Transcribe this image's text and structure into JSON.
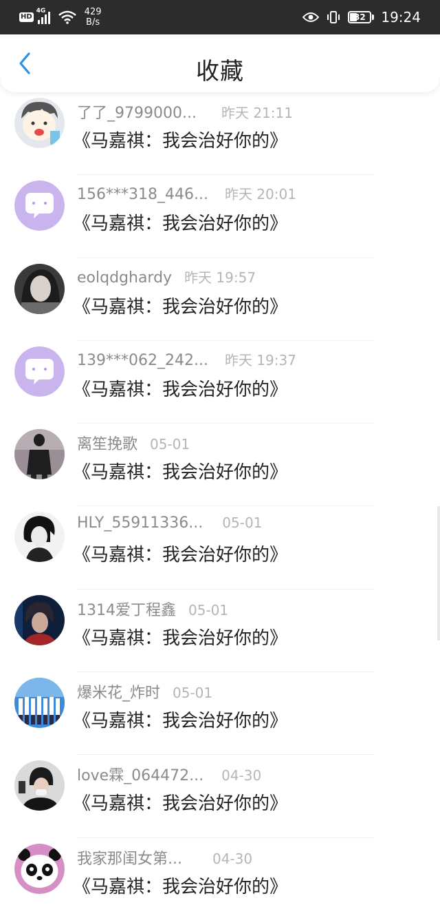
{
  "status_bar": {
    "hd": "HD",
    "signal_label": "4G",
    "net_speed_value": "429",
    "net_speed_unit": "B/s",
    "battery": "32",
    "time": "19:24"
  },
  "header": {
    "title": "收藏"
  },
  "items": [
    {
      "username": "了了_9799000...",
      "time": "昨天 21:11",
      "title": "《马嘉祺：我会治好你的》"
    },
    {
      "username": "156***318_446...",
      "time": "昨天 20:01",
      "title": "《马嘉祺：我会治好你的》"
    },
    {
      "username": "eolqdghardy",
      "time": "昨天 19:57",
      "title": "《马嘉祺：我会治好你的》"
    },
    {
      "username": "139***062_242...",
      "time": "昨天 19:37",
      "title": "《马嘉祺：我会治好你的》"
    },
    {
      "username": "离笙挽歌",
      "time": "05-01",
      "title": "《马嘉祺：我会治好你的》"
    },
    {
      "username": "HLY_55911336...",
      "time": "05-01",
      "title": "《马嘉祺：我会治好你的》"
    },
    {
      "username": "1314爱丁程鑫",
      "time": "05-01",
      "title": "《马嘉祺：我会治好你的》"
    },
    {
      "username": "爆米花_炸时",
      "time": "05-01",
      "title": "《马嘉祺：我会治好你的》"
    },
    {
      "username": "love霖_064472...",
      "time": "04-30",
      "title": "《马嘉祺：我会治好你的》"
    },
    {
      "username": "我家那闺女第...",
      "time": "04-30",
      "title": "《马嘉祺：我会治好你的》"
    }
  ],
  "colors": {
    "accent": "#2e8fe6",
    "status_bar_bg": "#2c2c2c",
    "username": "#8a8a8a",
    "time": "#b5b5b5",
    "title": "#222222"
  }
}
